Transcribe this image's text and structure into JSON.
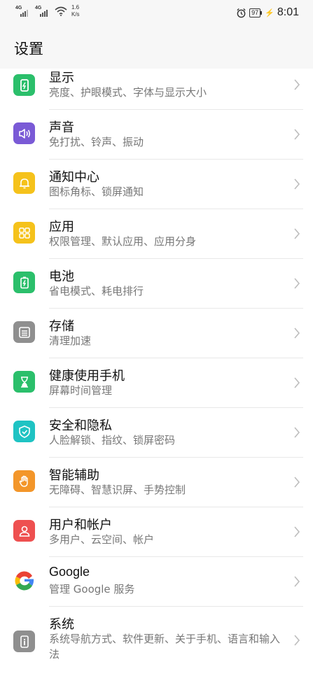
{
  "status_bar": {
    "signal1": "4G",
    "signal2": "4G",
    "speed_value": "1.6",
    "speed_unit": "K/s",
    "battery": "97",
    "time": "8:01"
  },
  "header": {
    "title": "设置"
  },
  "items": [
    {
      "title": "显示",
      "subtitle": "亮度、护眼模式、字体与显示大小",
      "icon": "display-icon",
      "color": "#2bbf6b"
    },
    {
      "title": "声音",
      "subtitle": "免打扰、铃声、振动",
      "icon": "sound-icon",
      "color": "#7a5ad6"
    },
    {
      "title": "通知中心",
      "subtitle": "图标角标、锁屏通知",
      "icon": "bell-icon",
      "color": "#f5c21b"
    },
    {
      "title": "应用",
      "subtitle": "权限管理、默认应用、应用分身",
      "icon": "apps-grid-icon",
      "color": "#f5c21b"
    },
    {
      "title": "电池",
      "subtitle": "省电模式、耗电排行",
      "icon": "battery-icon",
      "color": "#2bbf6b"
    },
    {
      "title": "存储",
      "subtitle": "清理加速",
      "icon": "storage-icon",
      "color": "#8f8f8f"
    },
    {
      "title": "健康使用手机",
      "subtitle": "屏幕时间管理",
      "icon": "hourglass-icon",
      "color": "#2bbf6b"
    },
    {
      "title": "安全和隐私",
      "subtitle": "人脸解锁、指纹、锁屏密码",
      "icon": "shield-icon",
      "color": "#1fc3c3"
    },
    {
      "title": "智能辅助",
      "subtitle": "无障碍、智慧识屏、手势控制",
      "icon": "hand-icon",
      "color": "#f3962a"
    },
    {
      "title": "用户和帐户",
      "subtitle": "多用户、云空间、帐户",
      "icon": "user-icon",
      "color": "#ee5050"
    },
    {
      "title": "Google",
      "subtitle": "管理 Google 服务",
      "icon": "google-icon",
      "color": "#ffffff"
    },
    {
      "title": "系统",
      "subtitle": "系统导航方式、软件更新、关于手机、语言和输入法",
      "icon": "phone-info-icon",
      "color": "#8f8f8f"
    }
  ]
}
